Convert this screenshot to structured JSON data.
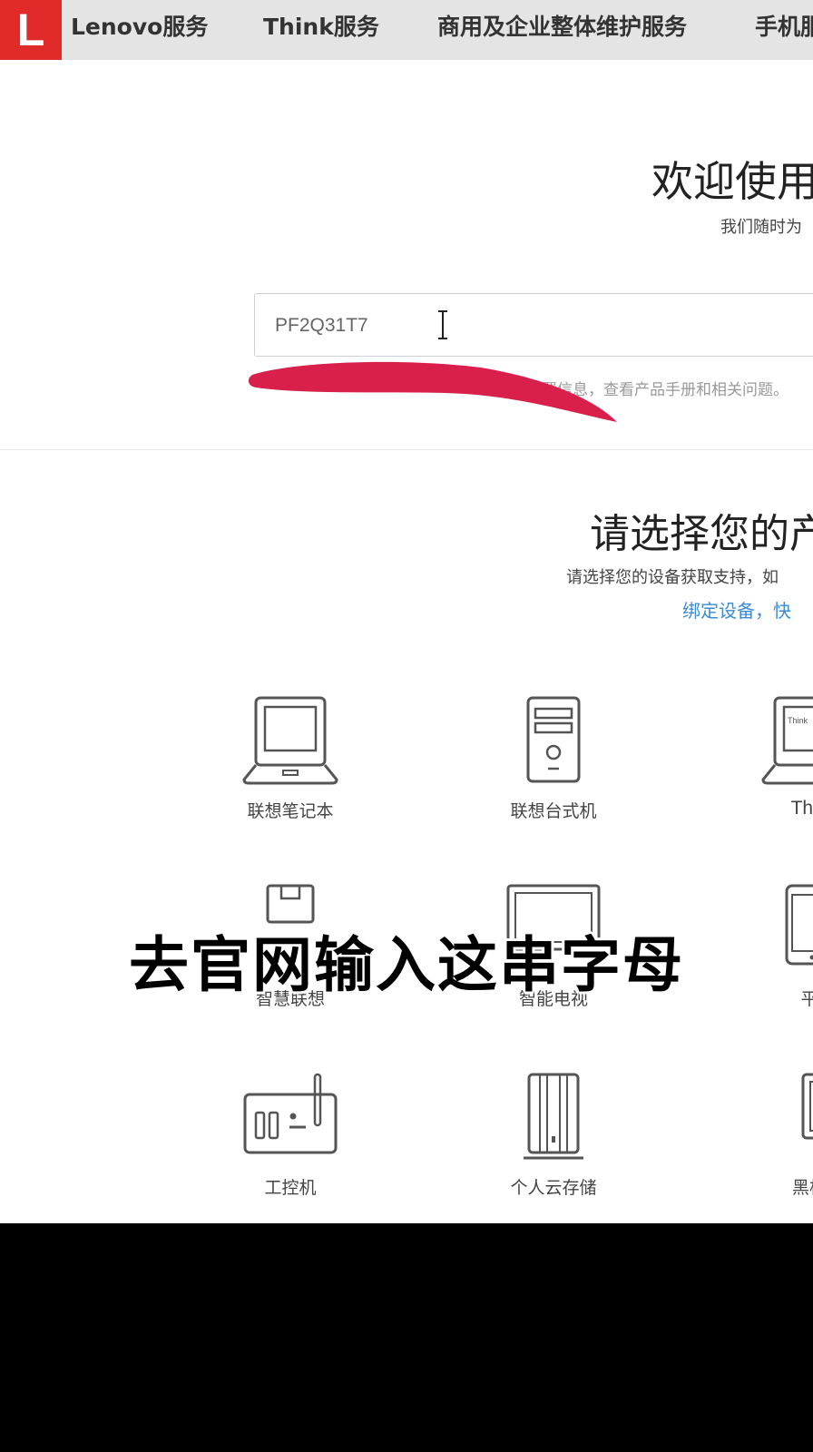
{
  "nav": {
    "logo_letter": "L",
    "items": [
      "Lenovo服务",
      "Think服务",
      "商用及企业整体维护服务",
      "手机服"
    ]
  },
  "hero": {
    "title": "欢迎使用",
    "subtitle": "我们随时为",
    "search_value": "PF2Q31T7",
    "hint": "配置信息，查看产品手册和相关问题。"
  },
  "products_section": {
    "title": "请选择您的产",
    "subtitle": "请选择您的设备获取支持，如",
    "link": "绑定设备，快"
  },
  "products": [
    {
      "label": "联想笔记本",
      "icon": "laptop-icon"
    },
    {
      "label": "联想台式机",
      "icon": "desktop-tower-icon"
    },
    {
      "label": "Thin",
      "icon": "thinkpad-icon"
    },
    {
      "label": "智慧联想",
      "icon": "smart-device-icon"
    },
    {
      "label": "智能电视",
      "icon": "tv-icon"
    },
    {
      "label": "平",
      "icon": "tablet-icon"
    },
    {
      "label": "工控机",
      "icon": "industrial-pc-icon"
    },
    {
      "label": "个人云存储",
      "icon": "cloud-storage-icon"
    },
    {
      "label": "黑板",
      "icon": "blackboard-icon"
    }
  ],
  "overlay_caption": "去官网输入这串字母",
  "colors": {
    "brand_red": "#e12b2b",
    "link_blue": "#3b8bd6",
    "redaction_red": "#d91f4b"
  }
}
